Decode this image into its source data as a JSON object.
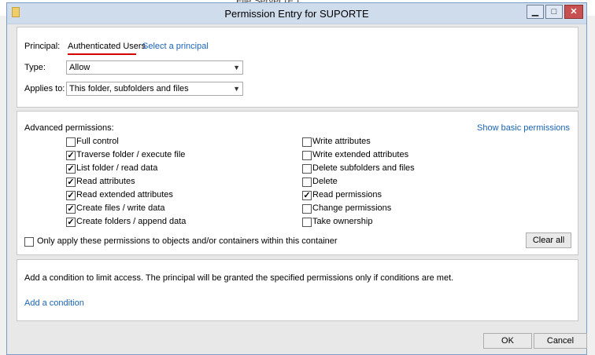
{
  "background": {
    "title": "File Server (F:)"
  },
  "dialog": {
    "title": "Permission Entry for SUPORTE",
    "window_buttons": {
      "minimize": "▁",
      "maximize": "□",
      "close": "✕"
    }
  },
  "principal": {
    "label": "Principal:",
    "value": "Authenticated Users",
    "link": "Select a principal"
  },
  "type": {
    "label": "Type:",
    "value": "Allow"
  },
  "applies_to": {
    "label": "Applies to:",
    "value": "This folder, subfolders and files"
  },
  "advanced": {
    "heading": "Advanced permissions:",
    "show_basic_link": "Show basic permissions",
    "left": [
      {
        "label": "Full control",
        "checked": false
      },
      {
        "label": "Traverse folder / execute file",
        "checked": true
      },
      {
        "label": "List folder / read data",
        "checked": true
      },
      {
        "label": "Read attributes",
        "checked": true
      },
      {
        "label": "Read extended attributes",
        "checked": true
      },
      {
        "label": "Create files / write data",
        "checked": true
      },
      {
        "label": "Create folders / append data",
        "checked": true
      }
    ],
    "right": [
      {
        "label": "Write attributes",
        "checked": false
      },
      {
        "label": "Write extended attributes",
        "checked": false
      },
      {
        "label": "Delete subfolders and files",
        "checked": false
      },
      {
        "label": "Delete",
        "checked": false
      },
      {
        "label": "Read permissions",
        "checked": true
      },
      {
        "label": "Change permissions",
        "checked": false
      },
      {
        "label": "Take ownership",
        "checked": false
      }
    ],
    "only_apply": {
      "label": "Only apply these permissions to objects and/or containers within this container",
      "checked": false
    },
    "clear_all": "Clear all"
  },
  "condition": {
    "text": "Add a condition to limit access. The principal will be granted the specified permissions only if conditions are met.",
    "link": "Add a condition"
  },
  "buttons": {
    "ok": "OK",
    "cancel": "Cancel"
  },
  "check_mark": "✓"
}
